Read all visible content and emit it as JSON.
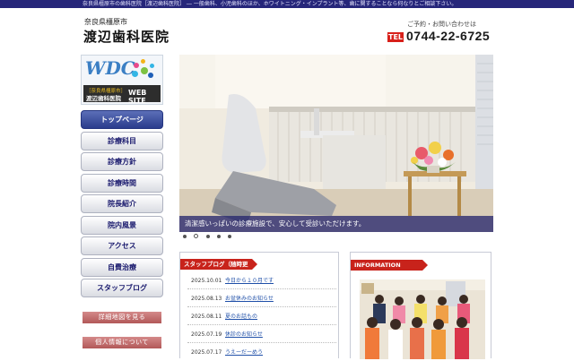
{
  "topbar": {
    "text": "奈良県橿原市の歯科医院［渡辺歯科医院］ ― 一般歯科、小児歯科のほか、ホワイトニング・インプラント等、歯に関することなら何なりとご相談下さい。"
  },
  "header": {
    "subtitle": "奈良県橿原市",
    "clinic_name": "渡辺歯科医院",
    "contact_label": "ご予約・お問い合わせは",
    "tel_badge": "TEL",
    "tel_number": "0744-22-6725"
  },
  "logo": {
    "mark": "WDC",
    "line1": "［奈良県橿原市］",
    "line2": "渡辺歯科医院",
    "line3": "WEB SITE"
  },
  "nav": {
    "items": [
      {
        "label": "トップページ"
      },
      {
        "label": "診療科目"
      },
      {
        "label": "診療方針"
      },
      {
        "label": "診療時間"
      },
      {
        "label": "院長紹介"
      },
      {
        "label": "院内風景"
      },
      {
        "label": "アクセス"
      },
      {
        "label": "自費治療"
      },
      {
        "label": "スタッフブログ"
      }
    ]
  },
  "side_buttons": {
    "map": "詳細地図を見る",
    "privacy": "個人情報について"
  },
  "hero": {
    "caption": "清潔感いっぱいの診療施設で、安心して受診いただけます。"
  },
  "blog": {
    "heading": "スタッフブログ（随時更新）",
    "rows": [
      {
        "date": "2025.10.01",
        "title": "今日から１０月です"
      },
      {
        "date": "2025.08.13",
        "title": "お盆休みのお知らせ"
      },
      {
        "date": "2025.08.11",
        "title": "夏のお話もの"
      },
      {
        "date": "2025.07.19",
        "title": "休診のお知らせ"
      },
      {
        "date": "2025.07.17",
        "title": "うえーだーめう"
      }
    ]
  },
  "info": {
    "heading": "INFORMATION"
  },
  "colors": {
    "navy": "#26267a",
    "accent_red": "#c8231b",
    "link_blue": "#1f4fa8"
  }
}
